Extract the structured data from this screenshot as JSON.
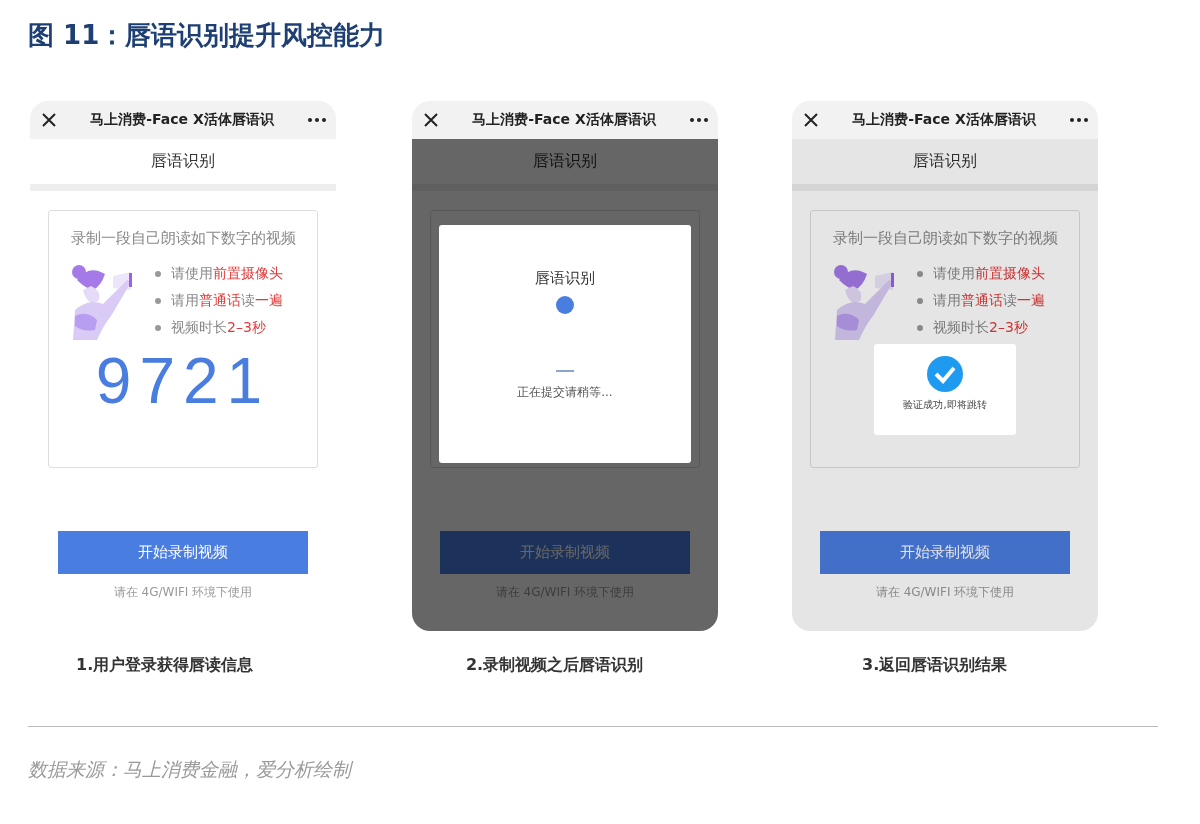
{
  "figure_title": "图 11：唇语识别提升风控能力",
  "screens": [
    {
      "header_title": "马上消费-Face X活体唇语识",
      "subtitle": "唇语识别",
      "kind": "plain",
      "card": {
        "prompt": "录制一段自己朗读如下数字的视频",
        "tips": [
          "请使用**前置摄像头**",
          "请用**普通话**读**一遍**",
          "视频时长**2–3秒**"
        ],
        "number": "9721"
      },
      "button": "开始录制视频",
      "note": "请在 4G/WIFI 环境下使用",
      "caption": "1.用户登录获得唇读信息"
    },
    {
      "header_title": "马上消费-Face X活体唇语识",
      "subtitle": "唇语识别",
      "kind": "dimmed",
      "dialog": {
        "kind": "loading",
        "title": "唇语识别",
        "message": "正在提交请稍等..."
      },
      "button": "开始录制视频",
      "note": "请在 4G/WIFI 环境下使用",
      "caption": "2.录制视频之后唇语识别"
    },
    {
      "header_title": "马上消费-Face X活体唇语识",
      "subtitle": "唇语识别",
      "kind": "faded",
      "card": {
        "prompt": "录制一段自己朗读如下数字的视频",
        "tips": [
          "请使用**前置摄像头**",
          "请用**普通话**读**一遍**",
          "视频时长**2–3秒**"
        ]
      },
      "dialog": {
        "kind": "success",
        "message": "验证成功,即将跳转"
      },
      "button": "开始录制视频",
      "note": "请在 4G/WIFI 环境下使用",
      "caption": "3.返回唇语识别结果"
    }
  ],
  "source": "数据来源：马上消费金融，爱分析绘制"
}
